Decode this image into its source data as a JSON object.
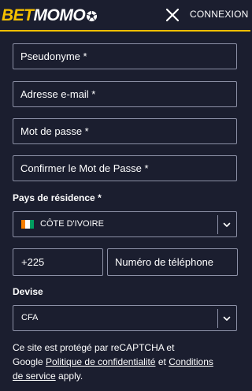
{
  "header": {
    "logo_bet": "BET",
    "logo_momo": "MOMO",
    "connexion_label": "CONNEXION"
  },
  "form": {
    "pseudonyme_placeholder": "Pseudonyme *",
    "email_placeholder": "Adresse e-mail *",
    "password_placeholder": "Mot de passe *",
    "confirm_password_placeholder": "Confirmer le Mot de Passe *",
    "country_label": "Pays de résidence *",
    "country_value": "CÔTE D'IVOIRE",
    "phone_code": "+225",
    "phone_placeholder": "Numéro de téléphone",
    "currency_label": "Devise",
    "currency_value": "CFA"
  },
  "recaptcha": {
    "line1": "Ce site est protégé par reCAPTCHA et",
    "google": "Google",
    "privacy_link": "Politique de confidentialité",
    "and": "et",
    "terms_link_1": "Conditions",
    "terms_link_2": "de service",
    "apply": "apply."
  },
  "colors": {
    "background": "#1b1e2f",
    "accent": "#f5c000",
    "border": "#8c90a6",
    "flag": [
      "#f77f00",
      "#ffffff",
      "#009e60"
    ]
  }
}
